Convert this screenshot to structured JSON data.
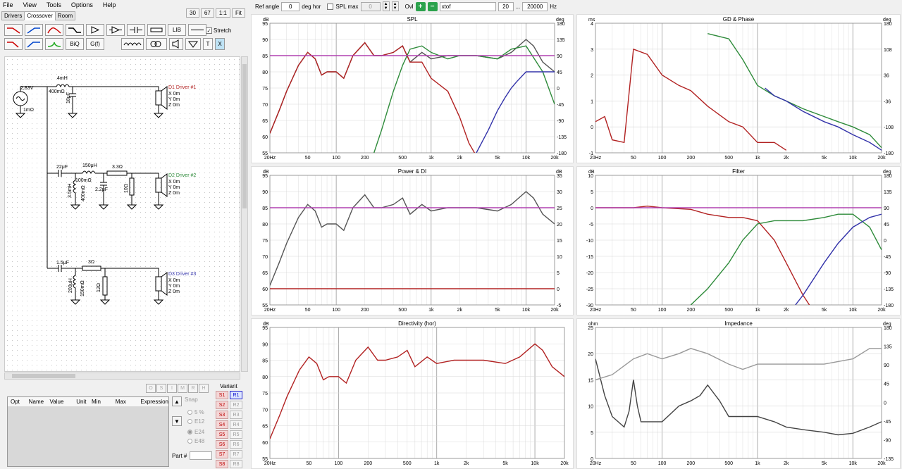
{
  "menu": [
    "File",
    "View",
    "Tools",
    "Options",
    "Help"
  ],
  "top_buttons": [
    "30",
    "67",
    "1:1",
    "Fit"
  ],
  "tabs": [
    "Drivers",
    "Crossover",
    "Room"
  ],
  "toolbar": {
    "lib": "LIB",
    "biq": "BiQ",
    "gf": "G(f)",
    "t": "T",
    "x": "X",
    "stretch": "Stretch"
  },
  "schematic": {
    "source_v": "2,83V",
    "source_r": "1mΩ",
    "l1": "4mH",
    "l1r": "400mΩ",
    "c1": "18μF",
    "d1": "D1 Driver #1",
    "d2": "D2 Driver #2",
    "d3": "D3 Driver #3",
    "xyz": [
      "X 0m",
      "Y 0m",
      "Z 0m"
    ],
    "c2": "22μF",
    "l2": "150μH",
    "l2r": "100mΩ",
    "r2": "3.3Ω",
    "l3": "3.5mH",
    "l3r": "400mΩ",
    "c3": "2.2μF",
    "r3": "10Ω",
    "c4": "1.5μF",
    "r4": "3Ω",
    "l4": "200μH",
    "l4r": "150mΩ",
    "r5": "12Ω"
  },
  "opt": {
    "buttons": [
      "O",
      "S",
      "I",
      "M",
      "R",
      "H"
    ],
    "columns": [
      "Opt",
      "Name",
      "Value",
      "Unit",
      "Min",
      "Max",
      "Expression"
    ],
    "snap_label": "Snap",
    "snap": [
      "5 %",
      "E12",
      "E24",
      "E48"
    ],
    "part_label": "Part #"
  },
  "variant": {
    "label": "Variant",
    "s": [
      "S1",
      "S2",
      "S3",
      "S4",
      "S5",
      "S6",
      "S7",
      "S8"
    ],
    "r": [
      "R1",
      "R2",
      "R3",
      "R4",
      "R5",
      "R6",
      "R7",
      "R8"
    ]
  },
  "controls": {
    "ref_angle_label": "Ref angle",
    "ref_angle": "0",
    "deg_hor": "deg hor",
    "splmax_label": "SPL max",
    "splmax": "0",
    "ovl": "Ovl",
    "xtof": "xtof",
    "f_lo": "20",
    "dots": "...",
    "f_hi": "20000",
    "hz": "Hz"
  },
  "freq_ticks": [
    "20Hz",
    "50",
    "100",
    "200",
    "500",
    "1k",
    "2k",
    "5k",
    "10k",
    "20k"
  ],
  "charts": [
    {
      "id": "spl",
      "title": "SPL",
      "lunit": "dB",
      "runit": "deg",
      "lticks": [
        "95",
        "90",
        "85",
        "80",
        "75",
        "70",
        "65",
        "60",
        "55"
      ],
      "rticks": [
        "180",
        "135",
        "90",
        "45",
        "0",
        "-45",
        "-90",
        "-135",
        "-180"
      ]
    },
    {
      "id": "gd",
      "title": "GD & Phase",
      "lunit": "ms",
      "runit": "deg",
      "lticks": [
        "4",
        "3",
        "2",
        "1",
        "0",
        "-1"
      ],
      "rticks": [
        "180",
        "108",
        "36",
        "-36",
        "-108",
        "-180"
      ]
    },
    {
      "id": "power",
      "title": "Power & DI",
      "lunit": "dB",
      "runit": "dB",
      "lticks": [
        "95",
        "90",
        "85",
        "80",
        "75",
        "70",
        "65",
        "60",
        "55"
      ],
      "rticks": [
        "35",
        "30",
        "25",
        "20",
        "15",
        "10",
        "5",
        "0",
        "-5"
      ]
    },
    {
      "id": "filter",
      "title": "Filter",
      "lunit": "dB",
      "runit": "deg",
      "lticks": [
        "10",
        "5",
        "0",
        "-5",
        "-10",
        "-15",
        "-20",
        "-25",
        "-30"
      ],
      "rticks": [
        "180",
        "135",
        "90",
        "45",
        "0",
        "-45",
        "-90",
        "-135",
        "-180"
      ]
    },
    {
      "id": "dir",
      "title": "Directivity (hor)",
      "lunit": "dB",
      "runit": "",
      "lticks": [
        "95",
        "90",
        "85",
        "80",
        "75",
        "70",
        "65",
        "60",
        "55"
      ],
      "rticks": []
    },
    {
      "id": "imp",
      "title": "Impedance",
      "lunit": "ohm",
      "runit": "deg",
      "lticks": [
        "25",
        "20",
        "15",
        "10",
        "5",
        "0"
      ],
      "rticks": [
        "180",
        "135",
        "90",
        "45",
        "0",
        "-45",
        "-90",
        "-135"
      ]
    }
  ],
  "chart_data": [
    {
      "type": "line",
      "title": "SPL",
      "ylabel": "dB",
      "xlim": [
        20,
        20000
      ],
      "ylim": [
        55,
        95
      ],
      "xscale": "log",
      "grid": true,
      "series": [
        {
          "color": "#555555",
          "x": [
            20,
            25,
            30,
            40,
            50,
            60,
            70,
            80,
            100,
            120,
            150,
            200,
            250,
            300,
            400,
            500,
            600,
            800,
            1000,
            1500,
            2000,
            3000,
            5000,
            7000,
            10000,
            12000,
            15000,
            20000
          ],
          "y": [
            61,
            68,
            74,
            82,
            86,
            84,
            79,
            80,
            80,
            78,
            85,
            89,
            85,
            85,
            86,
            88,
            83,
            86,
            84,
            85,
            85,
            85,
            84,
            86,
            90,
            88,
            83,
            80
          ]
        },
        {
          "color": "#b22222",
          "x": [
            20,
            25,
            30,
            40,
            50,
            60,
            70,
            80,
            100,
            120,
            150,
            200,
            250,
            300,
            400,
            500,
            600,
            800,
            1000,
            1500,
            2000,
            2500,
            3000
          ],
          "y": [
            61,
            68,
            74,
            82,
            86,
            84,
            79,
            80,
            80,
            78,
            85,
            89,
            85,
            85,
            86,
            88,
            83,
            83,
            78,
            74,
            66,
            58,
            54
          ]
        },
        {
          "color": "#2e8b3a",
          "x": [
            250,
            300,
            400,
            500,
            600,
            800,
            1000,
            1500,
            2000,
            3000,
            5000,
            7000,
            10000,
            15000,
            20000
          ],
          "y": [
            55,
            62,
            74,
            82,
            87,
            88,
            86,
            84,
            85,
            85,
            84,
            87,
            88,
            80,
            70
          ]
        },
        {
          "color": "#3333aa",
          "x": [
            3000,
            4000,
            5000,
            6000,
            7000,
            8000,
            10000,
            12000,
            15000,
            20000
          ],
          "y": [
            55,
            62,
            68,
            72,
            75,
            77,
            80,
            80,
            80,
            80
          ]
        },
        {
          "color": "#b040b0",
          "x": [
            20,
            20000
          ],
          "y": [
            85,
            85
          ]
        }
      ]
    },
    {
      "type": "line",
      "title": "GD & Phase",
      "ylabel": "ms",
      "xlim": [
        20,
        20000
      ],
      "ylim": [
        -1,
        4
      ],
      "xscale": "log",
      "grid": true,
      "series": [
        {
          "color": "#b22222",
          "x": [
            20,
            25,
            30,
            40,
            50,
            70,
            100,
            150,
            200,
            300,
            500,
            700,
            1000,
            1500,
            2000
          ],
          "y": [
            0.2,
            0.4,
            -0.5,
            -0.6,
            3.0,
            2.8,
            2.0,
            1.6,
            1.4,
            0.8,
            0.2,
            0.0,
            -0.6,
            -0.6,
            -0.9
          ]
        },
        {
          "color": "#2e8b3a",
          "x": [
            300,
            500,
            700,
            1000,
            1500,
            2000,
            3000,
            5000,
            7000,
            10000,
            15000,
            20000
          ],
          "y": [
            3.6,
            3.4,
            2.6,
            1.6,
            1.2,
            1.0,
            0.7,
            0.4,
            0.2,
            0.0,
            -0.3,
            -0.8
          ]
        },
        {
          "color": "#3333aa",
          "x": [
            1200,
            1500,
            2000,
            3000,
            5000,
            7000,
            10000,
            15000,
            20000
          ],
          "y": [
            1.5,
            1.2,
            1.0,
            0.6,
            0.2,
            0.0,
            -0.3,
            -0.6,
            -0.9
          ]
        }
      ]
    },
    {
      "type": "line",
      "title": "Power & DI",
      "ylabel": "dB",
      "xlim": [
        20,
        20000
      ],
      "ylim": [
        55,
        95
      ],
      "xscale": "log",
      "grid": true,
      "series": [
        {
          "color": "#555555",
          "x": [
            20,
            25,
            30,
            40,
            50,
            60,
            70,
            80,
            100,
            120,
            150,
            200,
            250,
            300,
            400,
            500,
            600,
            800,
            1000,
            1500,
            2000,
            3000,
            5000,
            7000,
            10000,
            12000,
            15000,
            20000
          ],
          "y": [
            61,
            68,
            74,
            82,
            86,
            84,
            79,
            80,
            80,
            78,
            85,
            89,
            85,
            85,
            86,
            88,
            83,
            86,
            84,
            85,
            85,
            85,
            84,
            86,
            90,
            88,
            83,
            80
          ]
        },
        {
          "color": "#b040b0",
          "x": [
            20,
            20000
          ],
          "y": [
            85,
            85
          ]
        },
        {
          "color": "#b22222",
          "x": [
            20,
            20000
          ],
          "y": [
            60,
            60
          ]
        }
      ]
    },
    {
      "type": "line",
      "title": "Filter",
      "ylabel": "dB",
      "xlim": [
        20,
        20000
      ],
      "ylim": [
        -30,
        10
      ],
      "xscale": "log",
      "grid": true,
      "series": [
        {
          "color": "#b22222",
          "x": [
            20,
            50,
            70,
            100,
            200,
            300,
            500,
            700,
            1000,
            1500,
            2000,
            3000,
            3500
          ],
          "y": [
            0,
            0,
            0.5,
            0,
            -0.5,
            -2,
            -3,
            -3,
            -4,
            -10,
            -17,
            -27,
            -30
          ]
        },
        {
          "color": "#2e8b3a",
          "x": [
            200,
            300,
            500,
            700,
            1000,
            1500,
            2000,
            3000,
            5000,
            7000,
            10000,
            15000,
            20000
          ],
          "y": [
            -30,
            -25,
            -17,
            -10,
            -5,
            -4,
            -4,
            -4,
            -3,
            -2,
            -2,
            -6,
            -13
          ]
        },
        {
          "color": "#3333aa",
          "x": [
            2500,
            3000,
            5000,
            7000,
            10000,
            15000,
            20000
          ],
          "y": [
            -30,
            -27,
            -17,
            -11,
            -6,
            -3,
            -2
          ]
        },
        {
          "color": "#b040b0",
          "x": [
            20,
            20000
          ],
          "y": [
            0,
            0
          ]
        }
      ]
    },
    {
      "type": "line",
      "title": "Directivity (hor)",
      "ylabel": "dB",
      "xlim": [
        20,
        20000
      ],
      "ylim": [
        55,
        95
      ],
      "xscale": "log",
      "grid": true,
      "series": [
        {
          "color": "#b22222",
          "x": [
            20,
            25,
            30,
            40,
            50,
            60,
            70,
            80,
            100,
            120,
            150,
            200,
            250,
            300,
            400,
            500,
            600,
            800,
            1000,
            1500,
            2000,
            3000,
            5000,
            7000,
            10000,
            12000,
            15000,
            20000
          ],
          "y": [
            61,
            68,
            74,
            82,
            86,
            84,
            79,
            80,
            80,
            78,
            85,
            89,
            85,
            85,
            86,
            88,
            83,
            86,
            84,
            85,
            85,
            85,
            84,
            86,
            90,
            88,
            83,
            80
          ]
        }
      ]
    },
    {
      "type": "line",
      "title": "Impedance",
      "ylabel": "ohm",
      "xlim": [
        20,
        20000
      ],
      "ylim": [
        0,
        25
      ],
      "xscale": "log",
      "grid": true,
      "series": [
        {
          "color": "#444444",
          "x": [
            20,
            25,
            30,
            40,
            45,
            50,
            55,
            60,
            70,
            100,
            150,
            200,
            250,
            300,
            400,
            500,
            700,
            1000,
            1500,
            2000,
            3000,
            5000,
            7000,
            10000,
            15000,
            20000
          ],
          "y": [
            19,
            12,
            8,
            6,
            9,
            15,
            10,
            7,
            7,
            7,
            10,
            11,
            12,
            14,
            11,
            8,
            8,
            8,
            7,
            6,
            5.5,
            5,
            4.5,
            4.8,
            6,
            7
          ]
        },
        {
          "color": "#999999",
          "x": [
            20,
            30,
            50,
            70,
            100,
            150,
            200,
            300,
            500,
            700,
            1000,
            2000,
            5000,
            10000,
            15000,
            20000
          ],
          "y": [
            15,
            16,
            19,
            20,
            19,
            20,
            21,
            20,
            18,
            17,
            18,
            18,
            18,
            19,
            21,
            21
          ]
        }
      ]
    }
  ]
}
